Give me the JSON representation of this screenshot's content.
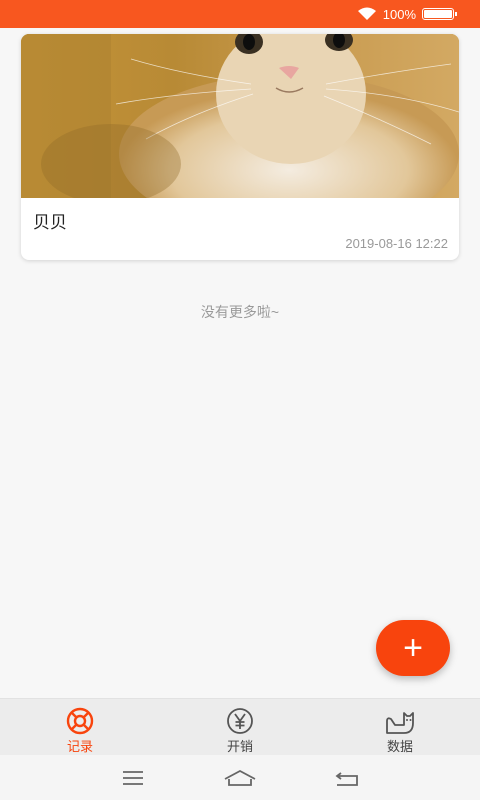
{
  "status_bar": {
    "battery_text": "100%",
    "background": "#f8571f",
    "icons": [
      "wifi-icon",
      "battery-icon"
    ]
  },
  "records": [
    {
      "name": "贝贝",
      "time": "2019-08-16 12:22",
      "photo": "cat-photo"
    }
  ],
  "list_end_text": "没有更多啦~",
  "fab": {
    "symbol": "+",
    "color": "#f8440d"
  },
  "tabs": [
    {
      "label": "记录",
      "icon": "lifebuoy-icon",
      "active": true
    },
    {
      "label": "开销",
      "icon": "yen-icon",
      "active": false
    },
    {
      "label": "数据",
      "icon": "cat-icon",
      "active": false
    }
  ],
  "accent_color": "#f8440d",
  "system_nav": [
    "menu-icon",
    "home-icon",
    "back-icon"
  ]
}
